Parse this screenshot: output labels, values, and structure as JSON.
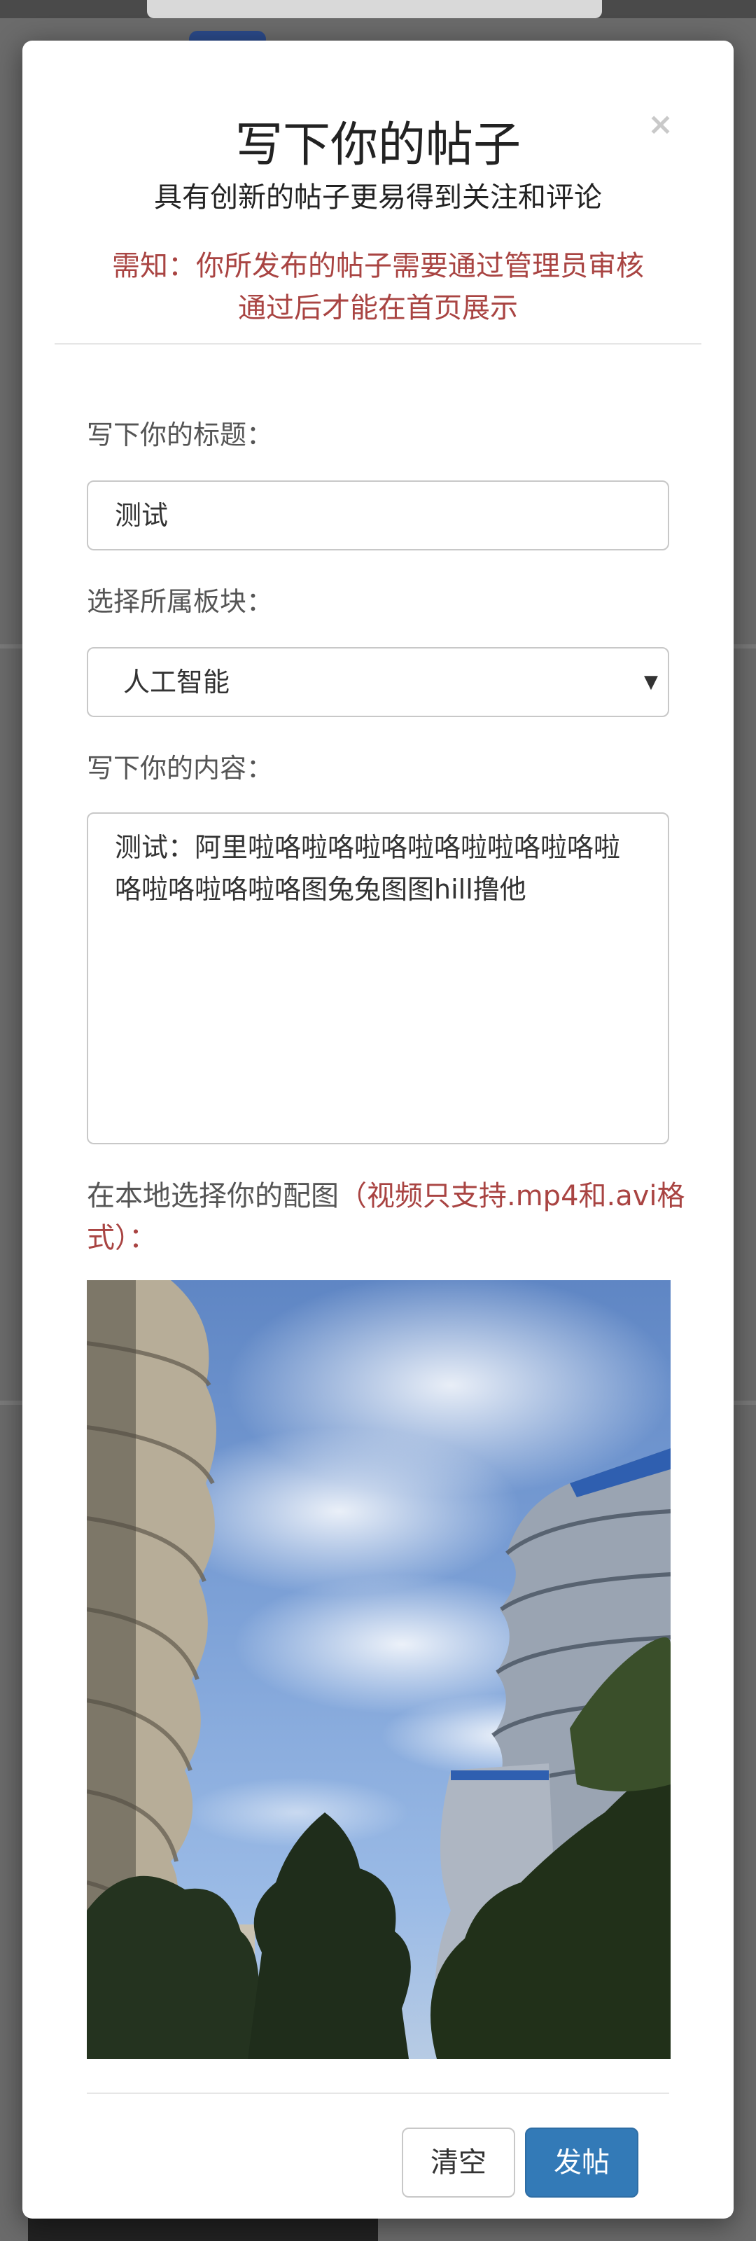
{
  "modal": {
    "close_glyph": "×",
    "title": "写下你的帖子",
    "subtitle": "具有创新的帖子更易得到关注和评论",
    "notice_line1": "需知：你所发布的帖子需要通过管理员审核",
    "notice_line2": "通过后才能在首页展示"
  },
  "form": {
    "title_label": "写下你的标题：",
    "title_value": "测试",
    "section_label": "选择所属板块：",
    "section_selected": "人工智能",
    "select_arrow": "▼",
    "content_label": "写下你的内容：",
    "content_value": "测试：阿里啦咯啦咯啦咯啦咯啦啦咯啦咯啦咯啦咯啦咯啦咯图兔兔图图hill撸他",
    "image_label_prefix": "在本地选择你的配图",
    "image_label_note": "（视频只支持.mp4和.avi格式）：",
    "image_alt": "sky-with-buildings-photo"
  },
  "buttons": {
    "clear_label": "清空",
    "post_label": "发帖"
  },
  "colors": {
    "notice_red": "#a94442",
    "primary_blue": "#337ab7"
  }
}
